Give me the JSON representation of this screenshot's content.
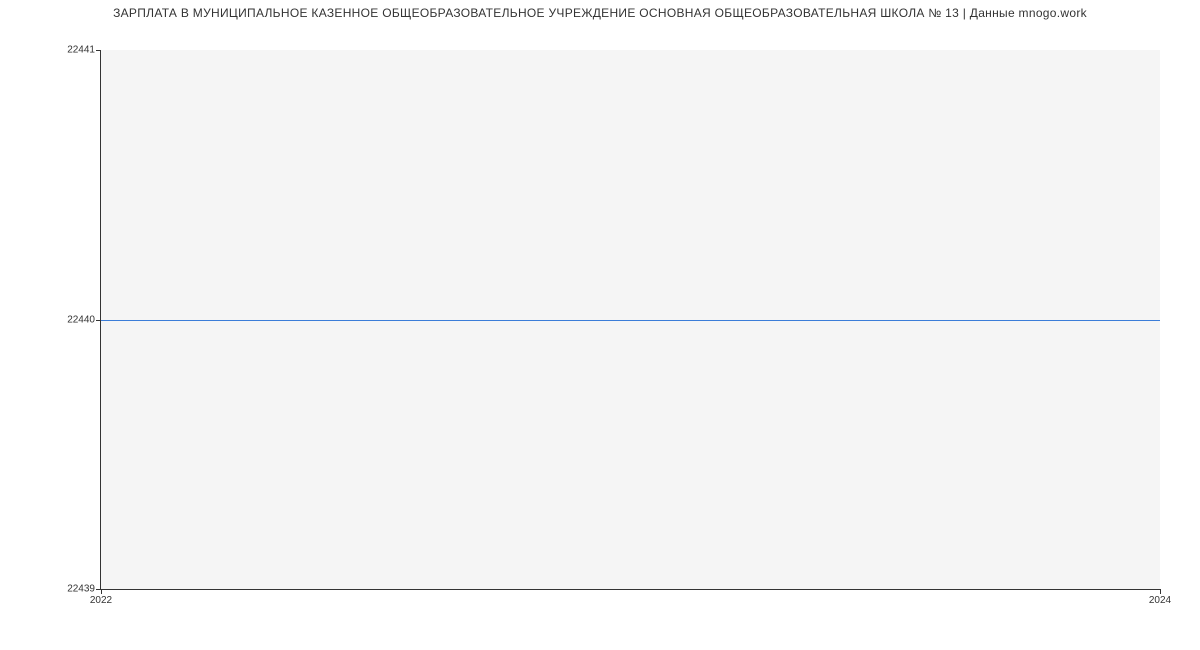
{
  "chart_data": {
    "type": "line",
    "title": "ЗАРПЛАТА В МУНИЦИПАЛЬНОЕ КАЗЕННОЕ ОБЩЕОБРАЗОВАТЕЛЬНОЕ УЧРЕЖДЕНИЕ ОСНОВНАЯ ОБЩЕОБРАЗОВАТЕЛЬНАЯ ШКОЛА № 13 | Данные mnogo.work",
    "x": [
      2022,
      2024
    ],
    "values": [
      22440,
      22440
    ],
    "xlabel": "",
    "ylabel": "",
    "x_ticks": [
      2022,
      2024
    ],
    "y_ticks": [
      22439,
      22440,
      22441
    ],
    "ylim": [
      22439,
      22441
    ],
    "xlim": [
      2022,
      2024
    ]
  }
}
